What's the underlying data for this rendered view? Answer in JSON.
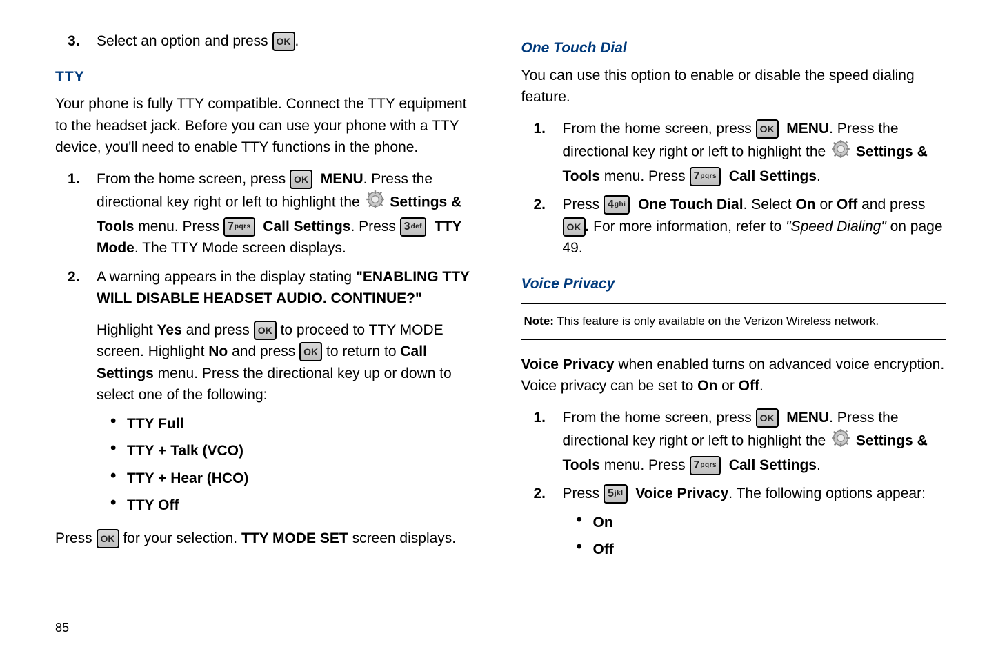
{
  "page_number": "85",
  "keys": {
    "ok": "OK",
    "7_big": "7",
    "7_small": "pqrs",
    "3_big": "3",
    "3_small": "def",
    "4_big": "4",
    "4_small": "ghi",
    "5_big": "5",
    "5_small": "jkl"
  },
  "left": {
    "item3_num": "3.",
    "item3_text_a": "Select an option and press ",
    "item3_text_b": ".",
    "tty_heading": "TTY",
    "tty_intro": "Your phone is fully TTY compatible. Connect the TTY equipment to the headset jack. Before you can use your phone with a TTY device, you'll need to enable TTY functions in the phone.",
    "s1_num": "1.",
    "s1_a": "From the home screen, press ",
    "s1_menu": "MENU",
    "s1_b": ". Press the directional key right or left to highlight the ",
    "s1_settings": "Settings & Tools",
    "s1_c": " menu. Press ",
    "s1_call": "Call Settings",
    "s1_d": ". Press ",
    "s1_tty": "TTY Mode",
    "s1_e": ". The TTY Mode screen displays.",
    "s2_num": "2.",
    "s2_a": "A warning appears in the display stating ",
    "s2_warn": "\"ENABLING TTY WILL DISABLE HEADSET AUDIO. CONTINUE?\"",
    "s2_p2_a": "Highlight ",
    "s2_yes": "Yes",
    "s2_p2_b": " and press ",
    "s2_p2_c": " to proceed to TTY MODE screen. Highlight ",
    "s2_no": "No",
    "s2_p2_d": " and press ",
    "s2_p2_e": " to return to ",
    "s2_callsettings": "Call Settings",
    "s2_p2_f": " menu. Press the directional key up or down to select one of the following:",
    "bullets": [
      "TTY Full",
      "TTY + Talk (VCO)",
      "TTY + Hear (HCO)",
      "TTY Off"
    ],
    "tail_a": "Press ",
    "tail_b": " for your selection. ",
    "tail_bold": "TTY MODE SET",
    "tail_c": " screen displays."
  },
  "right": {
    "otd_heading": "One Touch Dial",
    "otd_intro": "You can use this option to enable or disable the speed dialing feature.",
    "o1_num": "1.",
    "o1_a": "From the home screen, press ",
    "o1_menu": "MENU",
    "o1_b": ". Press the directional key right or left to highlight the ",
    "o1_settings": "Settings & Tools",
    "o1_c": " menu. Press ",
    "o1_call": "Call Settings",
    "o1_d": ".",
    "o2_num": "2.",
    "o2_a": "Press ",
    "o2_otd": "One Touch Dial",
    "o2_b": ". Select ",
    "o2_on": "On",
    "o2_c": " or ",
    "o2_off": "Off",
    "o2_d": " and press ",
    "o2_e": " For more information, refer to ",
    "o2_ref": "\"Speed Dialing\"",
    "o2_f": "  on page 49.",
    "vp_heading": "Voice Privacy",
    "note_label": "Note:",
    "note_text": " This feature is only available on the Verizon Wireless network.",
    "vp_intro_a": "Voice Privacy",
    "vp_intro_b": " when enabled turns on advanced voice encryption. Voice privacy can be set to ",
    "vp_on": "On",
    "vp_intro_c": " or ",
    "vp_off": "Off",
    "vp_intro_d": ".",
    "v1_num": "1.",
    "v1_a": "From the home screen, press ",
    "v1_menu": "MENU",
    "v1_b": ". Press the directional key right or left to highlight the ",
    "v1_settings": "Settings & Tools",
    "v1_c": " menu. Press ",
    "v1_call": "Call Settings",
    "v1_d": ".",
    "v2_num": "2.",
    "v2_a": "Press ",
    "v2_vp": "Voice Privacy",
    "v2_b": ". The following options appear:",
    "v_bullets": [
      "On",
      "Off"
    ]
  }
}
